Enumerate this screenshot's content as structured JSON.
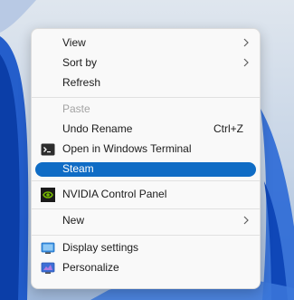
{
  "menu": {
    "view": {
      "label": "View",
      "icon": "chevron-right-icon"
    },
    "sort_by": {
      "label": "Sort by",
      "icon": "chevron-right-icon"
    },
    "refresh": {
      "label": "Refresh"
    },
    "paste": {
      "label": "Paste",
      "state": "disabled"
    },
    "undo_rename": {
      "label": "Undo Rename",
      "shortcut": "Ctrl+Z"
    },
    "open_terminal": {
      "label": "Open in Windows Terminal",
      "icon": "terminal-icon"
    },
    "steam": {
      "label": "Steam",
      "state": "highlighted"
    },
    "nvidia": {
      "label": "NVIDIA Control Panel",
      "icon": "nvidia-icon"
    },
    "new": {
      "label": "New",
      "icon": "chevron-right-icon"
    },
    "display_settings": {
      "label": "Display settings",
      "icon": "display-icon"
    },
    "personalize": {
      "label": "Personalize",
      "icon": "personalize-icon"
    }
  },
  "colors": {
    "highlight": "#0f6cc5",
    "menu_bg": "#f9f9f9",
    "disabled_text": "#a3a3a3",
    "wallpaper_blue": "#1a56c9"
  }
}
